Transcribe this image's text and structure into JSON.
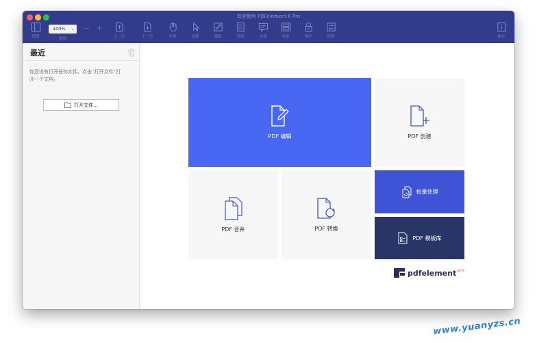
{
  "window": {
    "title": "欢迎使用 PDFelement 6 Pro"
  },
  "toolbar": {
    "zoom_value": "100%",
    "zoom_label": "缩放",
    "items": [
      {
        "label": "视图",
        "icon": "view-icon"
      },
      {
        "label": "上一页",
        "icon": "prev-page-icon"
      },
      {
        "label": "下一页",
        "icon": "next-page-icon"
      },
      {
        "label": "手型",
        "icon": "hand-icon"
      },
      {
        "label": "选择",
        "icon": "select-icon"
      },
      {
        "label": "编辑",
        "icon": "edit-icon"
      },
      {
        "label": "页面",
        "icon": "page-icon"
      },
      {
        "label": "注释",
        "icon": "comment-icon"
      },
      {
        "label": "表单",
        "icon": "form-icon"
      },
      {
        "label": "保护",
        "icon": "protect-icon"
      },
      {
        "label": "转换",
        "icon": "convert-icon"
      },
      {
        "label": "格式",
        "icon": "format-icon"
      }
    ]
  },
  "sidebar": {
    "title": "最近",
    "message": "你还没有打开任何文件。点击“打开文件”打开一个文档。",
    "open_button": "打开文件..."
  },
  "tiles": {
    "edit": "PDF 编辑",
    "create": "PDF 创建",
    "merge": "PDF 合并",
    "convert": "PDF 转换",
    "batch": "批量处理",
    "template": "PDF 模板库"
  },
  "brand": {
    "name": "pdfelement",
    "suffix": "pro"
  },
  "watermark": "www.yuanyzs.cn",
  "colors": {
    "titlebar": "#333c8c",
    "edit_tile": "#4867f2",
    "batch_tile": "#3f53d6",
    "template_tile": "#283566",
    "brand_accent": "#e3703a"
  }
}
